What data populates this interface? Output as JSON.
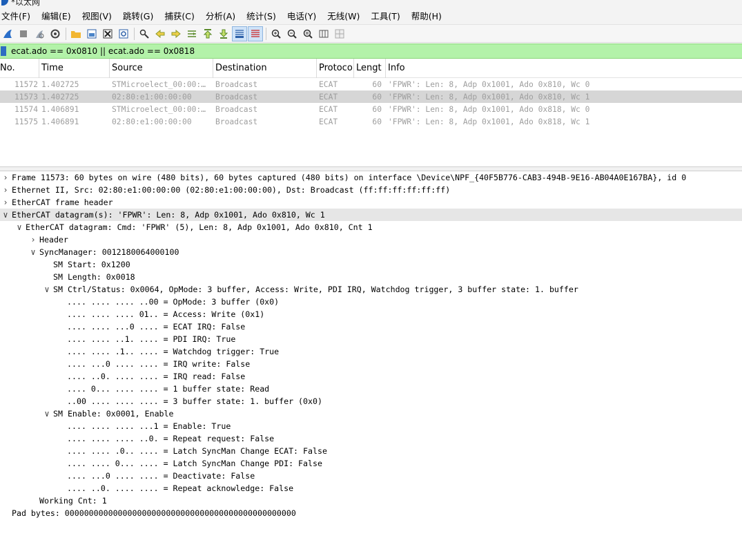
{
  "window": {
    "title": "*以太网"
  },
  "menu": [
    "文件(F)",
    "编辑(E)",
    "视图(V)",
    "跳转(G)",
    "捕获(C)",
    "分析(A)",
    "统计(S)",
    "电话(Y)",
    "无线(W)",
    "工具(T)",
    "帮助(H)"
  ],
  "toolbar": {
    "icons": [
      "shark-fin-start-icon",
      "stop-square-icon",
      "restart-shark-icon",
      "capture-options-gear-icon",
      "open-folder-icon",
      "save-file-icon",
      "close-file-icon",
      "reload-file-icon",
      "find-packet-icon",
      "go-back-icon",
      "go-forward-icon",
      "go-to-packet-icon",
      "go-first-icon",
      "go-last-icon",
      "autoscroll-icon",
      "colorize-icon",
      "zoom-in-icon",
      "zoom-out-icon",
      "zoom-normal-icon",
      "resize-columns-icon",
      "layout-icon"
    ]
  },
  "filter": {
    "value": "ecat.ado == 0x0810 || ecat.ado == 0x0818"
  },
  "packet_list": {
    "columns": [
      "No.",
      "Time",
      "Source",
      "Destination",
      "Protoco",
      "Lengt",
      "Info"
    ],
    "rows": [
      {
        "no": "11572",
        "time": "1.402725",
        "source": "STMicroelect_00:00:…",
        "destination": "Broadcast",
        "protocol": "ECAT",
        "length": "60",
        "info": "'FPWR': Len: 8, Adp 0x1001, Ado 0x810, Wc 0",
        "selected": false
      },
      {
        "no": "11573",
        "time": "1.402725",
        "source": "02:80:e1:00:00:00",
        "destination": "Broadcast",
        "protocol": "ECAT",
        "length": "60",
        "info": "'FPWR': Len: 8, Adp 0x1001, Ado 0x810, Wc 1",
        "selected": true
      },
      {
        "no": "11574",
        "time": "1.406891",
        "source": "STMicroelect_00:00:…",
        "destination": "Broadcast",
        "protocol": "ECAT",
        "length": "60",
        "info": "'FPWR': Len: 8, Adp 0x1001, Ado 0x818, Wc 0",
        "selected": false
      },
      {
        "no": "11575",
        "time": "1.406891",
        "source": "02:80:e1:00:00:00",
        "destination": "Broadcast",
        "protocol": "ECAT",
        "length": "60",
        "info": "'FPWR': Len: 8, Adp 0x1001, Ado 0x818, Wc 1",
        "selected": false
      }
    ]
  },
  "details": [
    {
      "level": 0,
      "arrow": "collapsed",
      "text": "Frame 11573: 60 bytes on wire (480 bits), 60 bytes captured (480 bits) on interface \\Device\\NPF_{40F5B776-CAB3-494B-9E16-AB04A0E167BA}, id 0"
    },
    {
      "level": 0,
      "arrow": "collapsed",
      "text": "Ethernet II, Src: 02:80:e1:00:00:00 (02:80:e1:00:00:00), Dst: Broadcast (ff:ff:ff:ff:ff:ff)"
    },
    {
      "level": 0,
      "arrow": "collapsed",
      "text": "EtherCAT frame header"
    },
    {
      "level": 0,
      "arrow": "expanded",
      "text": "EtherCAT datagram(s): 'FPWR': Len: 8, Adp 0x1001, Ado 0x810, Wc 1",
      "selected": true
    },
    {
      "level": 1,
      "arrow": "expanded",
      "text": "EtherCAT datagram: Cmd: 'FPWR' (5), Len: 8, Adp 0x1001, Ado 0x810, Cnt 1"
    },
    {
      "level": 2,
      "arrow": "collapsed",
      "text": "Header"
    },
    {
      "level": 2,
      "arrow": "expanded",
      "text": "SyncManager: 0012180064000100"
    },
    {
      "level": 3,
      "arrow": "none",
      "text": "SM Start: 0x1200"
    },
    {
      "level": 3,
      "arrow": "none",
      "text": "SM Length: 0x0018"
    },
    {
      "level": 3,
      "arrow": "expanded",
      "text": "SM Ctrl/Status: 0x0064, OpMode: 3 buffer, Access: Write, PDI IRQ, Watchdog trigger, 3 buffer state: 1. buffer"
    },
    {
      "level": 4,
      "arrow": "none",
      "text": ".... .... .... ..00 = OpMode: 3 buffer (0x0)"
    },
    {
      "level": 4,
      "arrow": "none",
      "text": ".... .... .... 01.. = Access: Write (0x1)"
    },
    {
      "level": 4,
      "arrow": "none",
      "text": ".... .... ...0 .... = ECAT IRQ: False"
    },
    {
      "level": 4,
      "arrow": "none",
      "text": ".... .... ..1. .... = PDI IRQ: True"
    },
    {
      "level": 4,
      "arrow": "none",
      "text": ".... .... .1.. .... = Watchdog trigger: True"
    },
    {
      "level": 4,
      "arrow": "none",
      "text": ".... ...0 .... .... = IRQ write: False"
    },
    {
      "level": 4,
      "arrow": "none",
      "text": ".... ..0. .... .... = IRQ read: False"
    },
    {
      "level": 4,
      "arrow": "none",
      "text": ".... 0... .... .... = 1 buffer state: Read"
    },
    {
      "level": 4,
      "arrow": "none",
      "text": "..00 .... .... .... = 3 buffer state: 1. buffer (0x0)"
    },
    {
      "level": 3,
      "arrow": "expanded",
      "text": "SM Enable: 0x0001, Enable"
    },
    {
      "level": 4,
      "arrow": "none",
      "text": ".... .... .... ...1 = Enable: True"
    },
    {
      "level": 4,
      "arrow": "none",
      "text": ".... .... .... ..0. = Repeat request: False"
    },
    {
      "level": 4,
      "arrow": "none",
      "text": ".... .... .0.. .... = Latch SyncMan Change ECAT: False"
    },
    {
      "level": 4,
      "arrow": "none",
      "text": ".... .... 0... .... = Latch SyncMan Change PDI: False"
    },
    {
      "level": 4,
      "arrow": "none",
      "text": ".... ...0 .... .... = Deactivate: False"
    },
    {
      "level": 4,
      "arrow": "none",
      "text": ".... ..0. .... .... = Repeat acknowledge: False"
    },
    {
      "level": 2,
      "arrow": "none",
      "text": "Working Cnt: 1"
    },
    {
      "level": 0,
      "arrow": "none",
      "text": "Pad bytes: 000000000000000000000000000000000000000000000000"
    }
  ]
}
